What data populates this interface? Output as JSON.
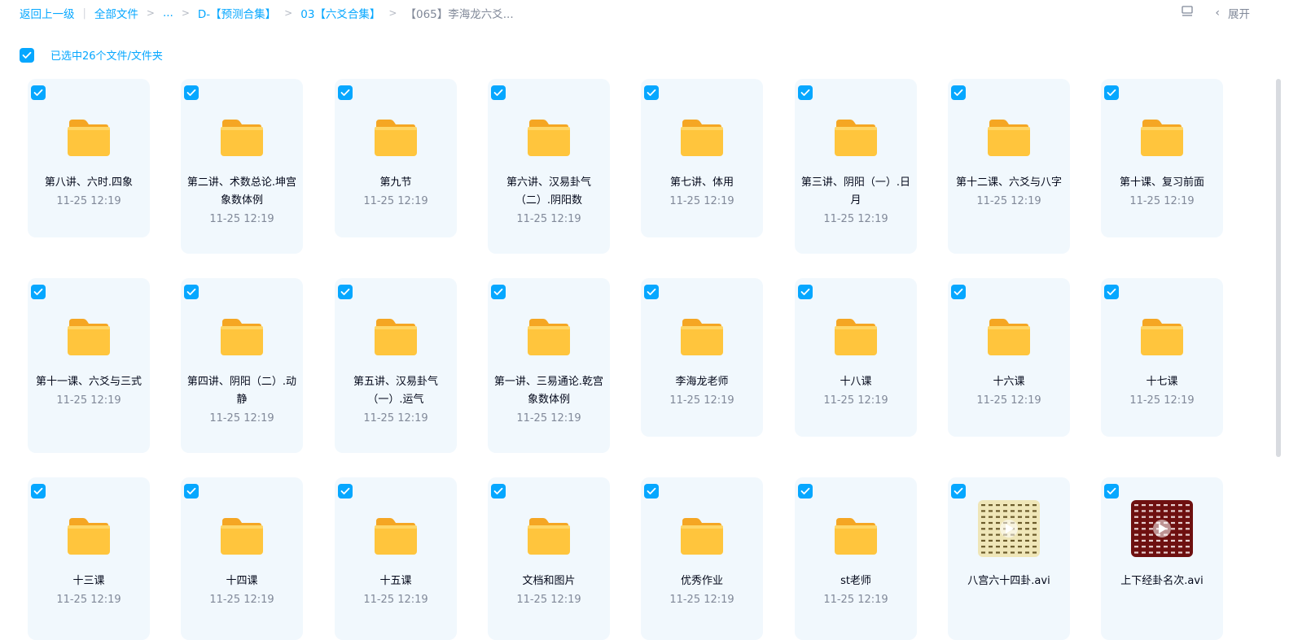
{
  "breadcrumb": {
    "back": "返回上一级",
    "all_files": "全部文件",
    "ellipsis": "...",
    "level1": "D-【预测合集】",
    "level2": "03【六爻合集】",
    "current": "【065】李海龙六爻..."
  },
  "toolbar": {
    "expand_label": "展开"
  },
  "selection": {
    "label": "已选中26个文件/文件夹"
  },
  "colors": {
    "accent": "#06a7ff",
    "folder": "#ffc53d",
    "card_bg": "#f1f8fd"
  },
  "items": [
    {
      "name": "第八讲、六时.四象",
      "date": "11-25 12:19",
      "type": "folder"
    },
    {
      "name": "第二讲、术数总论.坤宫象数体例",
      "date": "11-25 12:19",
      "type": "folder"
    },
    {
      "name": "第九节",
      "date": "11-25 12:19",
      "type": "folder"
    },
    {
      "name": "第六讲、汉易卦气（二）.阴阳数",
      "date": "11-25 12:19",
      "type": "folder"
    },
    {
      "name": "第七讲、体用",
      "date": "11-25 12:19",
      "type": "folder"
    },
    {
      "name": "第三讲、阴阳（一）.日月",
      "date": "11-25 12:19",
      "type": "folder"
    },
    {
      "name": "第十二课、六爻与八字",
      "date": "11-25 12:19",
      "type": "folder"
    },
    {
      "name": "第十课、复习前面",
      "date": "11-25 12:19",
      "type": "folder"
    },
    {
      "name": "第十一课、六爻与三式",
      "date": "11-25 12:19",
      "type": "folder"
    },
    {
      "name": "第四讲、阴阳（二）.动静",
      "date": "11-25 12:19",
      "type": "folder"
    },
    {
      "name": "第五讲、汉易卦气（一）.运气",
      "date": "11-25 12:19",
      "type": "folder"
    },
    {
      "name": "第一讲、三易通论.乾宫象数体例",
      "date": "11-25 12:19",
      "type": "folder"
    },
    {
      "name": "李海龙老师",
      "date": "11-25 12:19",
      "type": "folder"
    },
    {
      "name": "十八课",
      "date": "11-25 12:19",
      "type": "folder"
    },
    {
      "name": "十六课",
      "date": "11-25 12:19",
      "type": "folder"
    },
    {
      "name": "十七课",
      "date": "11-25 12:19",
      "type": "folder"
    },
    {
      "name": "十三课",
      "date": "11-25 12:19",
      "type": "folder"
    },
    {
      "name": "十四课",
      "date": "11-25 12:19",
      "type": "folder"
    },
    {
      "name": "十五课",
      "date": "11-25 12:19",
      "type": "folder"
    },
    {
      "name": "文档和图片",
      "date": "11-25 12:19",
      "type": "folder"
    },
    {
      "name": "优秀作业",
      "date": "11-25 12:19",
      "type": "folder"
    },
    {
      "name": "st老师",
      "date": "11-25 12:19",
      "type": "folder"
    },
    {
      "name": "八宫六十四卦.avi",
      "date": "",
      "type": "video",
      "thumb": "light"
    },
    {
      "name": "上下经卦名次.avi",
      "date": "",
      "type": "video",
      "thumb": "dark"
    }
  ]
}
